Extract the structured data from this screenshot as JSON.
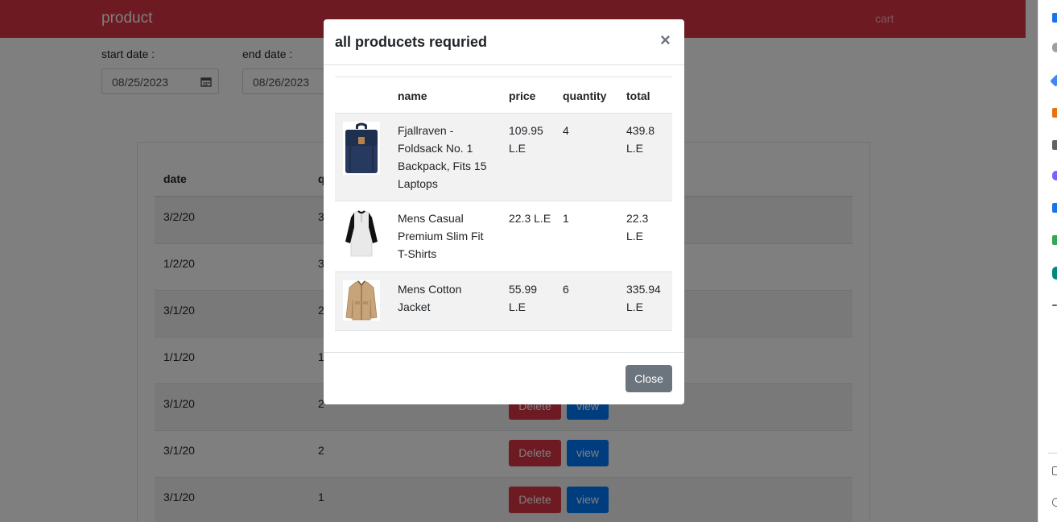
{
  "navbar": {
    "brand": "product",
    "cart": "cart"
  },
  "filters": {
    "start_label": "start date :",
    "start_value": "08/25/2023",
    "end_label": "end date :",
    "end_value": "08/26/2023"
  },
  "orders": {
    "headers": {
      "date": "date",
      "quantity": "q"
    },
    "delete_label": "Delete",
    "view_label": "view",
    "rows": [
      {
        "date": "3/2/20",
        "qty": "3"
      },
      {
        "date": "1/2/20",
        "qty": "3"
      },
      {
        "date": "3/1/20",
        "qty": "2"
      },
      {
        "date": "1/1/20",
        "qty": "1"
      },
      {
        "date": "3/1/20",
        "qty": "2"
      },
      {
        "date": "3/1/20",
        "qty": "2"
      },
      {
        "date": "3/1/20",
        "qty": "1"
      }
    ]
  },
  "modal": {
    "title": "all producets requried",
    "close_x": "×",
    "close_button": "Close",
    "headers": {
      "name": "name",
      "price": "price",
      "quantity": "quantity",
      "total": "total"
    },
    "products": [
      {
        "name": "Fjallraven - Foldsack No. 1 Backpack, Fits 15 Laptops",
        "price": "109.95 L.E",
        "quantity": "4",
        "total": "439.8 L.E",
        "icon": "backpack-image"
      },
      {
        "name": "Mens Casual Premium Slim Fit T-Shirts",
        "price": "22.3 L.E",
        "quantity": "1",
        "total": "22.3 L.E",
        "icon": "tshirt-image"
      },
      {
        "name": "Mens Cotton Jacket",
        "price": "55.99 L.E",
        "quantity": "6",
        "total": "335.94 L.E",
        "icon": "jacket-image"
      }
    ]
  },
  "colors": {
    "navbar": "#dc3545",
    "delete_button": "#dc3545",
    "view_button": "#007bff",
    "close_button": "#6c757d",
    "backdrop": "rgba(0,0,0,0.5)"
  }
}
